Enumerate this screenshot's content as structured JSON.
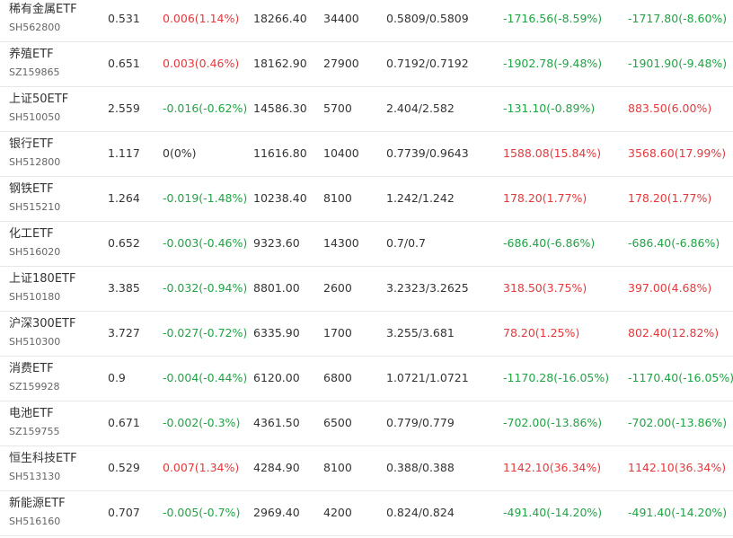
{
  "colors": {
    "up": "#e4393c",
    "down": "#21a345",
    "flat": "#333333"
  },
  "rows": [
    {
      "name": "稀有金属ETF",
      "code": "SH562800",
      "price": "0.531",
      "change": "0.006(1.14%)",
      "change_dir": "up",
      "volume": "18266.40",
      "shares": "34400",
      "range": "0.5809/0.5809",
      "pnl1": "-1716.56(-8.59%)",
      "pnl1_dir": "down",
      "pnl2": "-1717.80(-8.60%)",
      "pnl2_dir": "down"
    },
    {
      "name": "养殖ETF",
      "code": "SZ159865",
      "price": "0.651",
      "change": "0.003(0.46%)",
      "change_dir": "up",
      "volume": "18162.90",
      "shares": "27900",
      "range": "0.7192/0.7192",
      "pnl1": "-1902.78(-9.48%)",
      "pnl1_dir": "down",
      "pnl2": "-1901.90(-9.48%)",
      "pnl2_dir": "down"
    },
    {
      "name": "上证50ETF",
      "code": "SH510050",
      "price": "2.559",
      "change": "-0.016(-0.62%)",
      "change_dir": "down",
      "volume": "14586.30",
      "shares": "5700",
      "range": "2.404/2.582",
      "pnl1": "-131.10(-0.89%)",
      "pnl1_dir": "down",
      "pnl2": "883.50(6.00%)",
      "pnl2_dir": "up"
    },
    {
      "name": "银行ETF",
      "code": "SH512800",
      "price": "1.117",
      "change": "0(0%)",
      "change_dir": "flat",
      "volume": "11616.80",
      "shares": "10400",
      "range": "0.7739/0.9643",
      "pnl1": "1588.08(15.84%)",
      "pnl1_dir": "up",
      "pnl2": "3568.60(17.99%)",
      "pnl2_dir": "up"
    },
    {
      "name": "钢铁ETF",
      "code": "SH515210",
      "price": "1.264",
      "change": "-0.019(-1.48%)",
      "change_dir": "down",
      "volume": "10238.40",
      "shares": "8100",
      "range": "1.242/1.242",
      "pnl1": "178.20(1.77%)",
      "pnl1_dir": "up",
      "pnl2": "178.20(1.77%)",
      "pnl2_dir": "up"
    },
    {
      "name": "化工ETF",
      "code": "SH516020",
      "price": "0.652",
      "change": "-0.003(-0.46%)",
      "change_dir": "down",
      "volume": "9323.60",
      "shares": "14300",
      "range": "0.7/0.7",
      "pnl1": "-686.40(-6.86%)",
      "pnl1_dir": "down",
      "pnl2": "-686.40(-6.86%)",
      "pnl2_dir": "down"
    },
    {
      "name": "上证180ETF",
      "code": "SH510180",
      "price": "3.385",
      "change": "-0.032(-0.94%)",
      "change_dir": "down",
      "volume": "8801.00",
      "shares": "2600",
      "range": "3.2323/3.2625",
      "pnl1": "318.50(3.75%)",
      "pnl1_dir": "up",
      "pnl2": "397.00(4.68%)",
      "pnl2_dir": "up"
    },
    {
      "name": "沪深300ETF",
      "code": "SH510300",
      "price": "3.727",
      "change": "-0.027(-0.72%)",
      "change_dir": "down",
      "volume": "6335.90",
      "shares": "1700",
      "range": "3.255/3.681",
      "pnl1": "78.20(1.25%)",
      "pnl1_dir": "up",
      "pnl2": "802.40(12.82%)",
      "pnl2_dir": "up"
    },
    {
      "name": "消费ETF",
      "code": "SZ159928",
      "price": "0.9",
      "change": "-0.004(-0.44%)",
      "change_dir": "down",
      "volume": "6120.00",
      "shares": "6800",
      "range": "1.0721/1.0721",
      "pnl1": "-1170.28(-16.05%)",
      "pnl1_dir": "down",
      "pnl2": "-1170.40(-16.05%)",
      "pnl2_dir": "down"
    },
    {
      "name": "电池ETF",
      "code": "SZ159755",
      "price": "0.671",
      "change": "-0.002(-0.3%)",
      "change_dir": "down",
      "volume": "4361.50",
      "shares": "6500",
      "range": "0.779/0.779",
      "pnl1": "-702.00(-13.86%)",
      "pnl1_dir": "down",
      "pnl2": "-702.00(-13.86%)",
      "pnl2_dir": "down"
    },
    {
      "name": "恒生科技ETF",
      "code": "SH513130",
      "price": "0.529",
      "change": "0.007(1.34%)",
      "change_dir": "up",
      "volume": "4284.90",
      "shares": "8100",
      "range": "0.388/0.388",
      "pnl1": "1142.10(36.34%)",
      "pnl1_dir": "up",
      "pnl2": "1142.10(36.34%)",
      "pnl2_dir": "up"
    },
    {
      "name": "新能源ETF",
      "code": "SH516160",
      "price": "0.707",
      "change": "-0.005(-0.7%)",
      "change_dir": "down",
      "volume": "2969.40",
      "shares": "4200",
      "range": "0.824/0.824",
      "pnl1": "-491.40(-14.20%)",
      "pnl1_dir": "down",
      "pnl2": "-491.40(-14.20%)",
      "pnl2_dir": "down"
    }
  ]
}
